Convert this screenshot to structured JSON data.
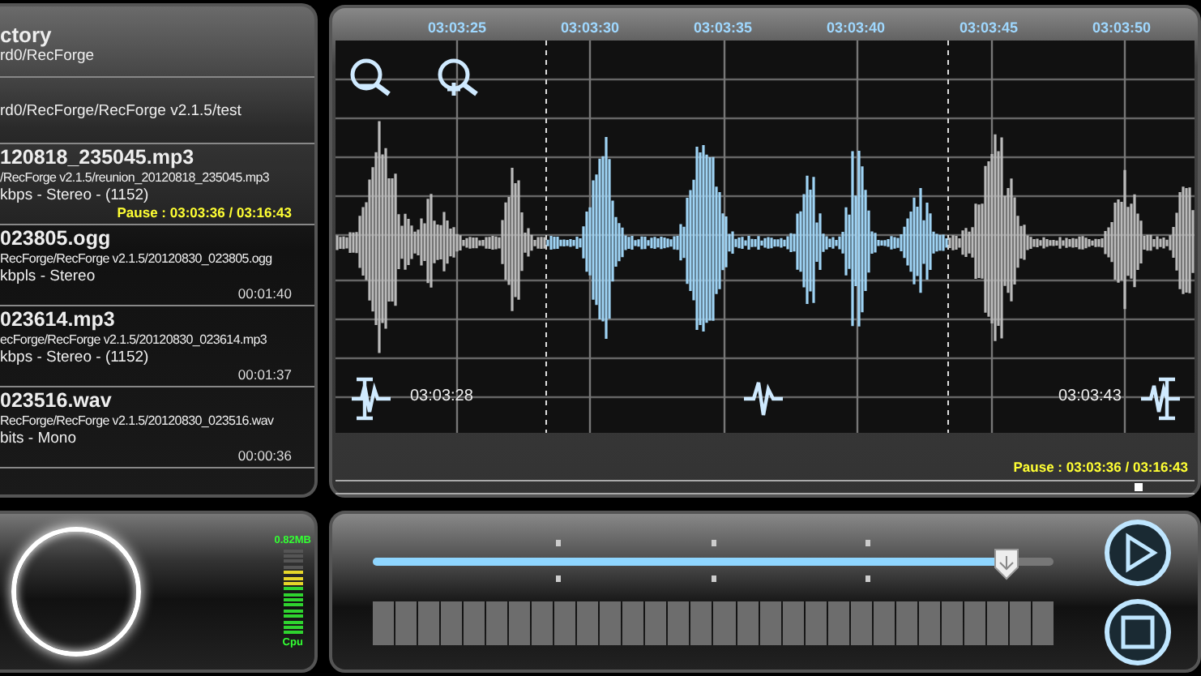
{
  "file_list": {
    "header": {
      "title": "ctory",
      "path": "rd0/RecForge"
    },
    "folder": "rd0/RecForge/RecForge v2.1.5/test",
    "files": [
      {
        "title": "120818_235045.mp3",
        "path": "/RecForge v2.1.5/reunion_20120818_235045.mp3",
        "info": "kbps - Stereo - (1152)",
        "status": "Pause : 03:03:36 / 03:16:43",
        "selected": true
      },
      {
        "title": "023805.ogg",
        "path": "RecForge/RecForge v2.1.5/20120830_023805.ogg",
        "info": "kbpls - Stereo",
        "status": "00:01:40",
        "selected": false
      },
      {
        "title": "023614.mp3",
        "path": "ecForge/RecForge v2.1.5/20120830_023614.mp3",
        "info": "kbps - Stereo - (1152)",
        "status": "00:01:37",
        "selected": false
      },
      {
        "title": "023516.wav",
        "path": "RecForge/RecForge v2.1.5/20120830_023516.wav",
        "info": "bits - Mono",
        "status": "00:00:36",
        "selected": false
      }
    ]
  },
  "waveform": {
    "ruler": [
      "03:03:25",
      "03:03:30",
      "03:03:35",
      "03:03:40",
      "03:03:45",
      "03:03:50"
    ],
    "marker_start": "03:03:28",
    "marker_end": "03:03:43",
    "status": "Pause : 03:03:36 / 03:16:43",
    "position": {
      "level": 0.93
    }
  },
  "recorder": {
    "memory": "0.82MB",
    "cpu_label": "Cpu",
    "cpu_meter": {
      "level": 0.75
    }
  },
  "transport": {
    "slider": {
      "level": 0.93
    }
  }
}
